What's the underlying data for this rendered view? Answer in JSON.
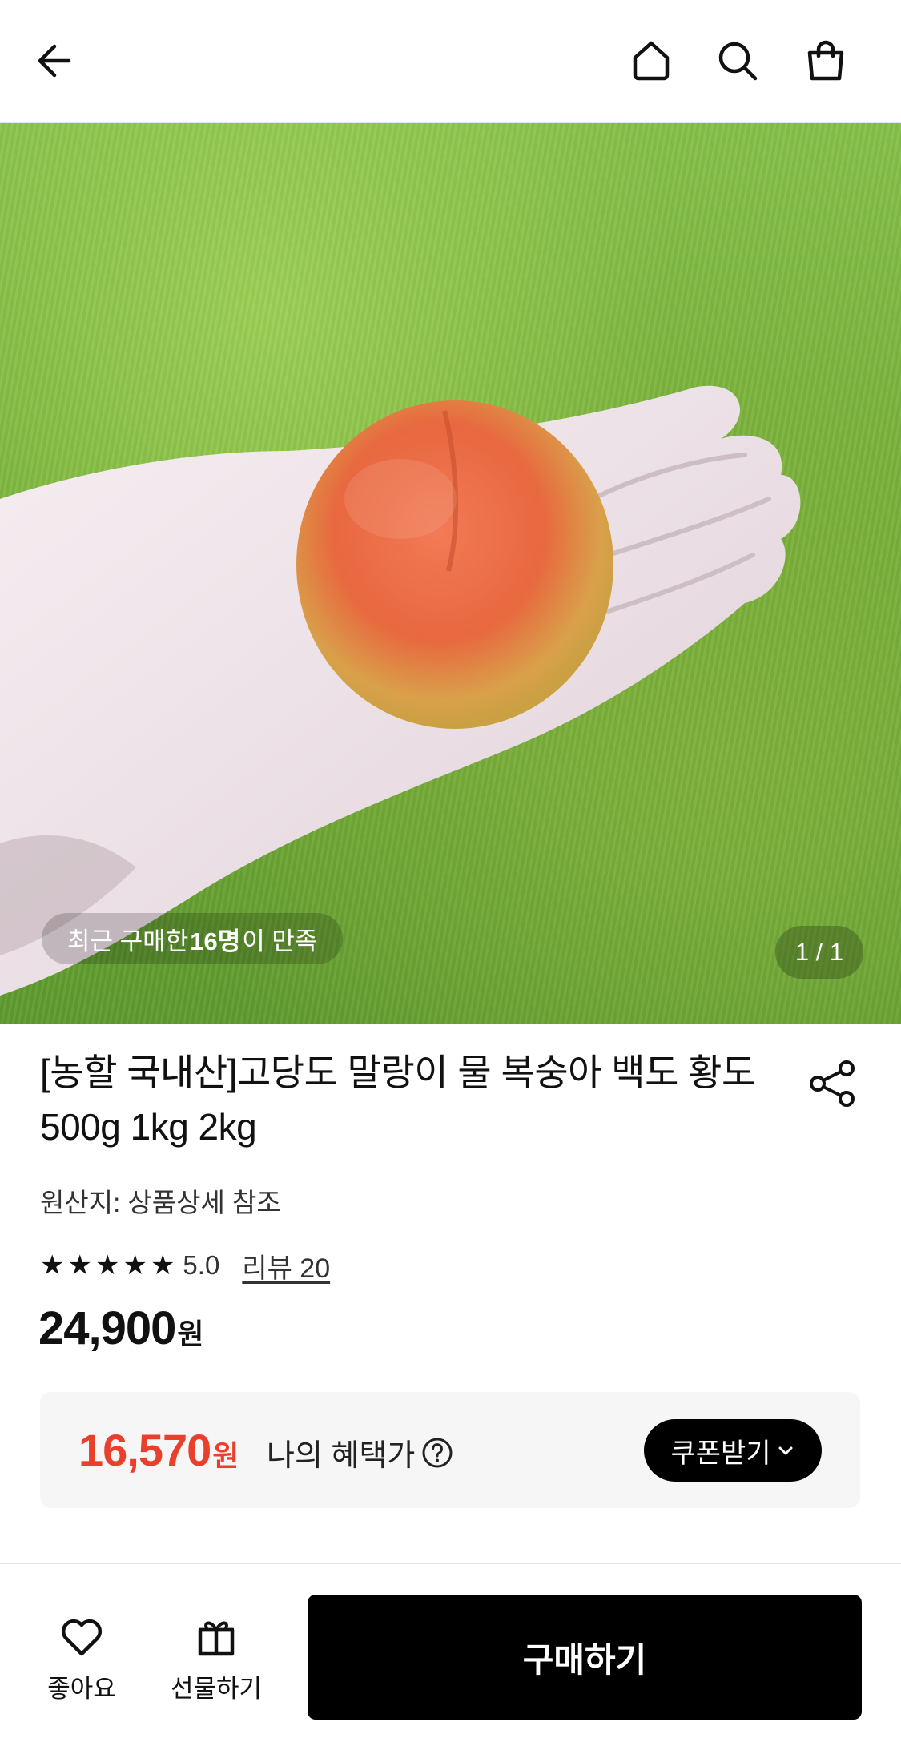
{
  "header": {
    "back_icon": "arrow-left-icon",
    "home_icon": "home-icon",
    "search_icon": "search-icon",
    "cart_icon": "shopping-bag-icon"
  },
  "hero": {
    "satisfaction_prefix": "최근 구매한 ",
    "satisfaction_count": "16명",
    "satisfaction_suffix": "이 만족",
    "counter": "1 / 1"
  },
  "product": {
    "title": "[농할 국내산]고당도 말랑이 물 복숭아 백도 황도 500g 1kg 2kg",
    "origin": "원산지: 상품상세 참조",
    "rating_stars": 5,
    "rating_score": "5.0",
    "reviews": "리뷰 20",
    "price": "24,900",
    "price_unit": "원"
  },
  "benefit": {
    "price": "16,570",
    "price_unit": "원",
    "label": "나의 혜택가",
    "coupon_label": "쿠폰받기",
    "accent_color": "#e8402d"
  },
  "bottom_bar": {
    "like_label": "좋아요",
    "gift_label": "선물하기",
    "buy_label": "구매하기"
  }
}
